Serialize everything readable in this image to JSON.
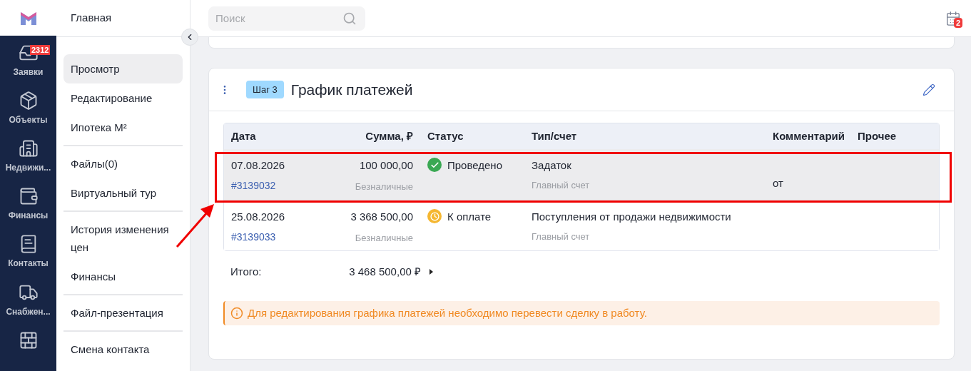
{
  "nav_rail": [
    {
      "label": "Заявки",
      "badge": "2312",
      "selected": false
    },
    {
      "label": "Объекты",
      "selected": false
    },
    {
      "label": "Недвижи...",
      "selected": false
    },
    {
      "label": "Финансы",
      "selected": false
    },
    {
      "label": "Контакты",
      "selected": false
    },
    {
      "label": "Снабжен...",
      "selected": false
    },
    {
      "selected": false
    }
  ],
  "sidebar": {
    "title": "Главная",
    "groups": [
      [
        {
          "label": "Просмотр",
          "selected": true
        },
        {
          "label": "Редактирование",
          "selected": false
        },
        {
          "label": "Ипотека М²",
          "selected": false
        }
      ],
      [
        {
          "label": "Файлы(0)",
          "selected": false
        },
        {
          "label": "Виртуальный тур",
          "selected": false
        }
      ],
      [
        {
          "label": "История изменения цен",
          "selected": false
        },
        {
          "label": "Финансы",
          "selected": false
        }
      ],
      [
        {
          "label": "Файл-презентация",
          "selected": false
        }
      ],
      [
        {
          "label": "Смена контакта",
          "selected": false
        }
      ]
    ]
  },
  "search": {
    "placeholder": "Поиск"
  },
  "calendar_badge": "2",
  "card": {
    "step": "Шаг 3",
    "title": "График платежей",
    "columns": [
      "Дата",
      "Сумма, ₽",
      "Статус",
      "Тип/счет",
      "Комментарий",
      "Прочее"
    ],
    "rows": [
      {
        "date": "07.08.2026",
        "id": "#3139032",
        "amount": "100 000,00",
        "method": "Безналичные",
        "status": "Проведено",
        "kind": "done",
        "type": "Задаток",
        "account": "Главный счет",
        "comment": "от",
        "highlighted": true
      },
      {
        "date": "25.08.2026",
        "id": "#3139033",
        "amount": "3 368 500,00",
        "method": "Безналичные",
        "status": "К оплате",
        "kind": "pending",
        "type": "Поступления от продажи недвижимости",
        "account": "Главный счет",
        "highlighted": false
      }
    ],
    "total_label": "Итого:",
    "total": "3 468 500,00 ₽",
    "notice": "Для редактирования графика платежей необходимо перевести сделку в работу."
  }
}
